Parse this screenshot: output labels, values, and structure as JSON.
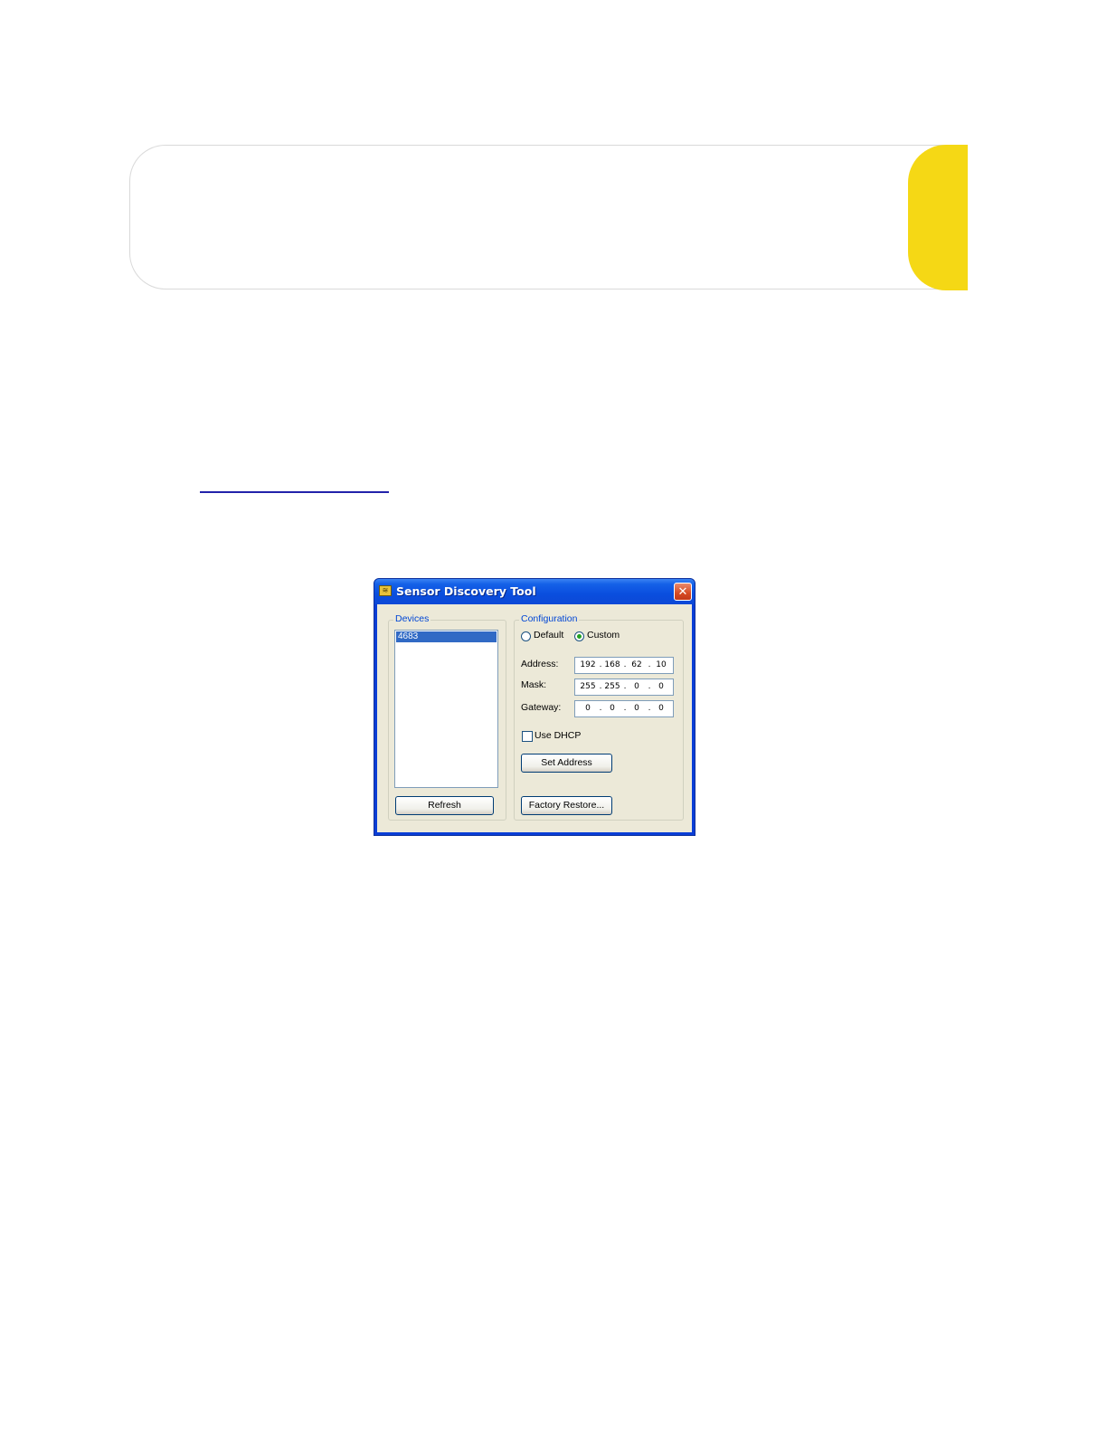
{
  "window": {
    "title": "Sensor Discovery Tool",
    "icon": "app-icon",
    "close_glyph": "✕"
  },
  "devices": {
    "group_label": "Devices",
    "items": [
      "4683"
    ],
    "refresh_label": "Refresh"
  },
  "configuration": {
    "group_label": "Configuration",
    "mode_options": [
      "Default",
      "Custom"
    ],
    "selected_mode": "Custom",
    "address_label": "Address:",
    "address": [
      "192",
      "168",
      "62",
      "10"
    ],
    "mask_label": "Mask:",
    "mask": [
      "255",
      "255",
      "0",
      "0"
    ],
    "gateway_label": "Gateway:",
    "gateway": [
      "0",
      "0",
      "0",
      "0"
    ],
    "use_dhcp_label": "Use DHCP",
    "use_dhcp_checked": false,
    "set_address_label": "Set Address",
    "factory_restore_label": "Factory Restore..."
  },
  "colors": {
    "accent_tab": "#f5d815",
    "titlebar": "#0a4ede",
    "selection": "#316ac5"
  }
}
